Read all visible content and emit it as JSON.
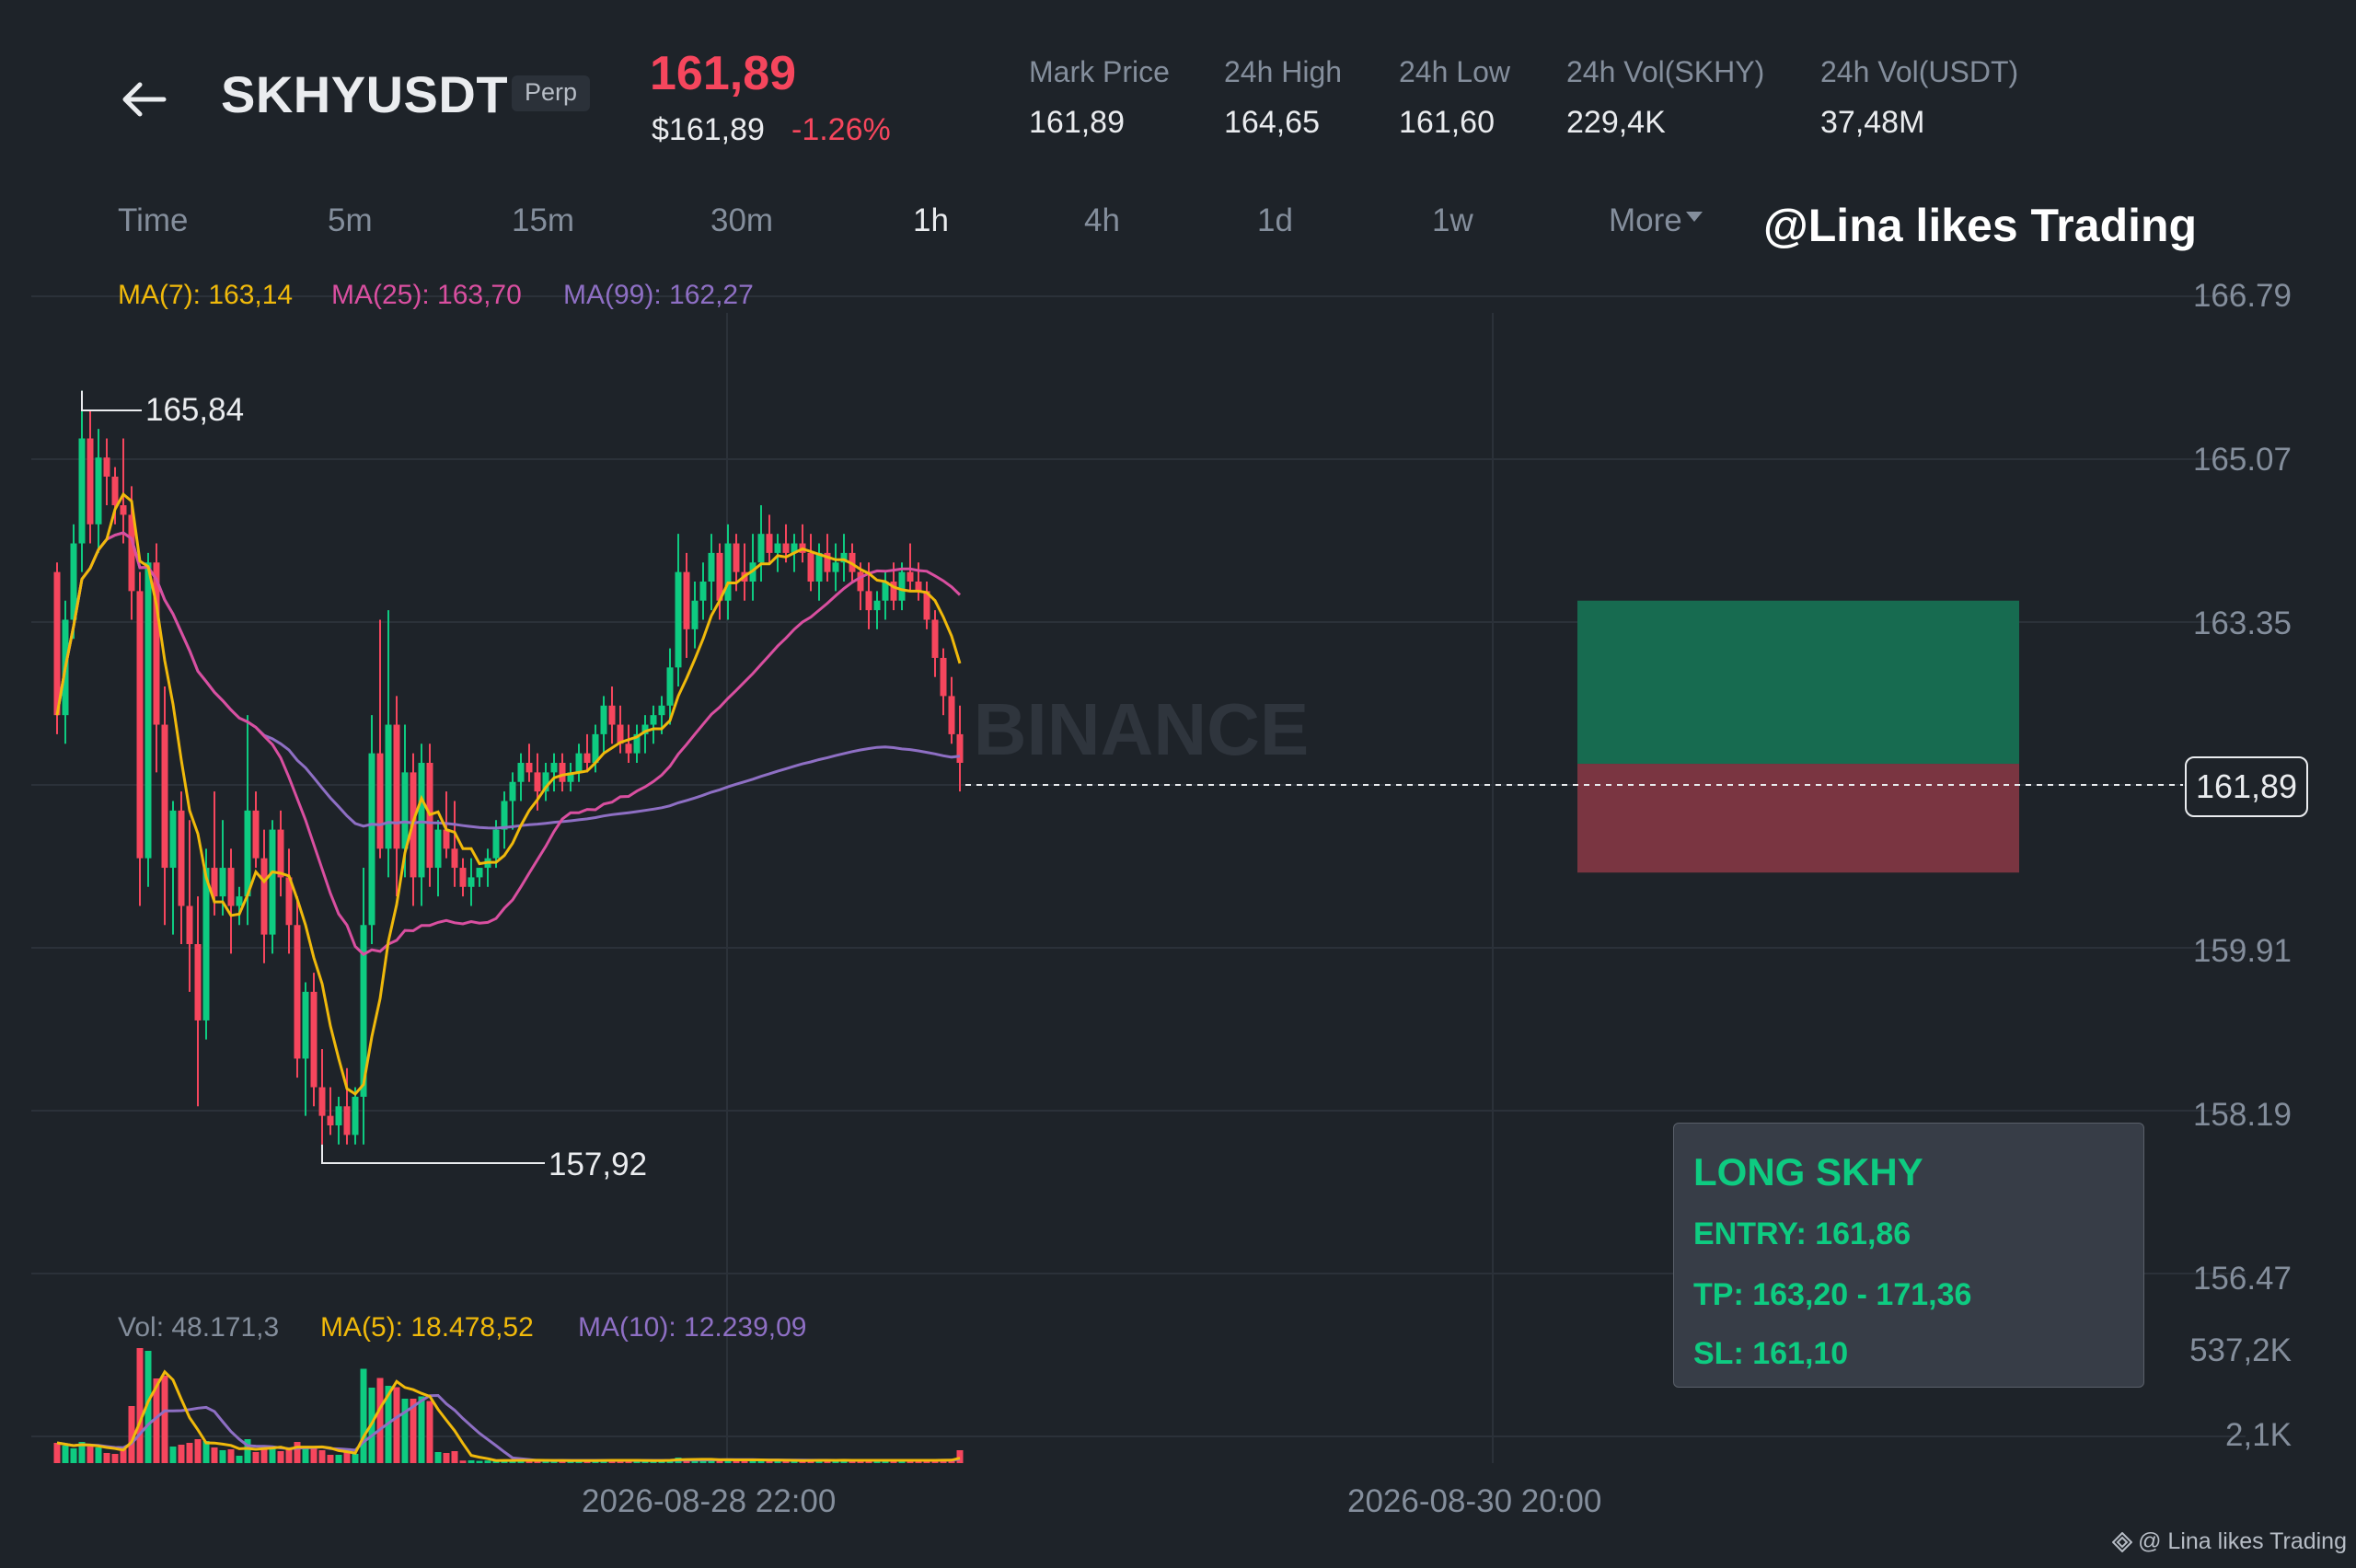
{
  "header": {
    "symbol": "SKHYUSDT",
    "badge": "Perp",
    "last_price": "161,89",
    "usd_price": "$161,89",
    "change_pct": "-1.26%",
    "stats": [
      {
        "label": "Mark Price",
        "value": "161,89"
      },
      {
        "label": "24h High",
        "value": "164,65"
      },
      {
        "label": "24h Low",
        "value": "161,60"
      },
      {
        "label": "24h Vol(SKHY)",
        "value": "229,4K"
      },
      {
        "label": "24h Vol(USDT)",
        "value": "37,48M"
      }
    ],
    "back_icon": "arrow-left-icon"
  },
  "timeframes": {
    "items": [
      "Time",
      "5m",
      "15m",
      "30m",
      "1h",
      "4h",
      "1d",
      "1w",
      "More"
    ],
    "active": "1h",
    "more_icon": "caret-down-icon"
  },
  "watermark": "@Lina likes Trading",
  "ma_legend": {
    "ma7": "MA(7): 163,14",
    "ma25": "MA(25): 163,70",
    "ma99": "MA(99): 162,27"
  },
  "price_axis": [
    "166.79",
    "165.07",
    "163.35",
    "161,89",
    "159.91",
    "158.19",
    "156.47"
  ],
  "current_price_tag": "161,89",
  "extremes": {
    "high": "165,84",
    "low": "157,92"
  },
  "volume_legend": {
    "vol": "Vol: 48.171,3",
    "ma5": "MA(5): 18.478,52",
    "ma10": "MA(10): 12.239,09"
  },
  "volume_axis": [
    "537,2K",
    "2,1K"
  ],
  "time_axis": [
    "2026-08-28 22:00",
    "2026-08-30 20:00"
  ],
  "signal": {
    "title": "LONG SKHY",
    "entry": "ENTRY: 161,86",
    "tp": "TP: 163,20 - 171,36",
    "sl": "SL: 161,10"
  },
  "footer_watermark": "@ Lina likes Trading",
  "colors": {
    "background": "#1e2329",
    "up": "#0ecb81",
    "down": "#f6465d",
    "ma7": "#f0b90b",
    "ma25": "#d94fa0",
    "ma99": "#8e6fc4",
    "tp_zone": "#176b50",
    "sl_zone": "#7a3541"
  },
  "chart_data": {
    "type": "candlestick",
    "interval": "1h",
    "price_range": [
      156.47,
      166.79
    ],
    "grid": true,
    "candles_ohlc": [
      [
        163.9,
        164.0,
        162.2,
        162.4
      ],
      [
        162.4,
        163.6,
        162.1,
        163.4
      ],
      [
        163.4,
        164.4,
        163.2,
        164.2
      ],
      [
        164.2,
        165.8,
        163.9,
        165.3
      ],
      [
        165.3,
        165.6,
        164.2,
        164.4
      ],
      [
        164.4,
        165.4,
        164.1,
        165.1
      ],
      [
        165.1,
        165.3,
        164.6,
        164.9
      ],
      [
        164.9,
        165.0,
        164.4,
        164.6
      ],
      [
        164.6,
        165.3,
        164.2,
        164.5
      ],
      [
        164.5,
        164.8,
        163.4,
        163.7
      ],
      [
        163.7,
        163.9,
        160.4,
        160.9
      ],
      [
        160.9,
        164.1,
        160.6,
        164.0
      ],
      [
        164.0,
        164.2,
        161.8,
        162.3
      ],
      [
        162.3,
        162.7,
        160.2,
        160.8
      ],
      [
        160.8,
        161.5,
        160.1,
        161.4
      ],
      [
        161.4,
        161.6,
        160.0,
        160.4
      ],
      [
        160.4,
        161.3,
        159.5,
        160.0
      ],
      [
        160.0,
        160.5,
        158.3,
        159.2
      ],
      [
        159.2,
        161.0,
        159.0,
        160.8
      ],
      [
        160.8,
        161.6,
        160.3,
        160.5
      ],
      [
        160.5,
        161.3,
        160.3,
        160.8
      ],
      [
        160.8,
        161.0,
        159.9,
        160.4
      ],
      [
        160.4,
        160.6,
        160.2,
        160.5
      ],
      [
        160.5,
        162.4,
        160.2,
        161.4
      ],
      [
        161.4,
        161.6,
        160.8,
        160.9
      ],
      [
        160.9,
        161.2,
        159.8,
        160.1
      ],
      [
        160.1,
        161.3,
        159.9,
        161.2
      ],
      [
        161.2,
        161.4,
        160.5,
        160.7
      ],
      [
        160.7,
        161.0,
        159.9,
        160.2
      ],
      [
        160.2,
        160.5,
        158.6,
        158.8
      ],
      [
        158.8,
        159.6,
        158.2,
        159.5
      ],
      [
        159.5,
        159.7,
        158.3,
        158.5
      ],
      [
        158.5,
        158.9,
        157.9,
        158.2
      ],
      [
        158.2,
        158.5,
        158.0,
        158.1
      ],
      [
        158.1,
        158.4,
        157.9,
        158.3
      ],
      [
        158.3,
        158.7,
        157.9,
        158.0
      ],
      [
        158.0,
        158.5,
        157.9,
        158.4
      ],
      [
        158.4,
        160.8,
        157.9,
        160.2
      ],
      [
        160.2,
        162.4,
        160.0,
        162.0
      ],
      [
        162.0,
        163.4,
        160.9,
        161.0
      ],
      [
        161.0,
        163.5,
        160.7,
        162.3
      ],
      [
        162.3,
        162.6,
        160.5,
        161.0
      ],
      [
        161.0,
        162.3,
        160.7,
        161.8
      ],
      [
        161.8,
        162.0,
        160.4,
        160.7
      ],
      [
        160.7,
        162.1,
        160.4,
        161.9
      ],
      [
        161.9,
        162.1,
        160.6,
        160.8
      ],
      [
        160.8,
        161.3,
        160.5,
        161.2
      ],
      [
        161.2,
        161.6,
        160.9,
        161.0
      ],
      [
        161.0,
        161.5,
        160.6,
        160.8
      ],
      [
        160.8,
        160.9,
        160.5,
        160.6
      ],
      [
        160.6,
        160.9,
        160.4,
        160.7
      ],
      [
        160.7,
        160.8,
        160.6,
        160.8
      ],
      [
        160.8,
        161.0,
        160.6,
        160.9
      ],
      [
        160.9,
        161.3,
        160.8,
        161.2
      ],
      [
        161.2,
        161.6,
        161.0,
        161.5
      ],
      [
        161.5,
        161.8,
        161.2,
        161.7
      ],
      [
        161.7,
        162.0,
        161.5,
        161.9
      ],
      [
        161.9,
        162.1,
        161.7,
        161.8
      ],
      [
        161.8,
        162.0,
        161.4,
        161.6
      ],
      [
        161.6,
        161.9,
        161.5,
        161.8
      ],
      [
        161.8,
        162.0,
        161.6,
        161.9
      ],
      [
        161.9,
        162.0,
        161.6,
        161.7
      ],
      [
        161.7,
        161.9,
        161.6,
        161.8
      ],
      [
        161.8,
        162.1,
        161.7,
        162.0
      ],
      [
        162.0,
        162.2,
        161.8,
        161.9
      ],
      [
        161.9,
        162.3,
        161.8,
        162.2
      ],
      [
        162.2,
        162.6,
        162.0,
        162.5
      ],
      [
        162.5,
        162.7,
        162.1,
        162.3
      ],
      [
        162.3,
        162.5,
        162.0,
        162.1
      ],
      [
        162.1,
        162.3,
        161.9,
        162.0
      ],
      [
        162.0,
        162.3,
        161.9,
        162.2
      ],
      [
        162.2,
        162.4,
        162.0,
        162.3
      ],
      [
        162.3,
        162.5,
        162.1,
        162.4
      ],
      [
        162.4,
        162.6,
        162.2,
        162.5
      ],
      [
        162.5,
        163.1,
        162.3,
        162.9
      ],
      [
        162.9,
        164.3,
        162.7,
        163.9
      ],
      [
        163.9,
        164.1,
        163.0,
        163.3
      ],
      [
        163.3,
        163.8,
        163.1,
        163.6
      ],
      [
        163.6,
        164.0,
        163.4,
        163.8
      ],
      [
        163.8,
        164.3,
        163.5,
        164.1
      ],
      [
        164.1,
        164.2,
        163.4,
        163.6
      ],
      [
        163.6,
        164.4,
        163.4,
        164.2
      ],
      [
        164.2,
        164.3,
        163.7,
        163.9
      ],
      [
        163.9,
        164.2,
        163.6,
        163.8
      ],
      [
        163.8,
        164.3,
        163.6,
        164.0
      ],
      [
        164.0,
        164.6,
        163.8,
        164.3
      ],
      [
        164.3,
        164.5,
        164.0,
        164.1
      ],
      [
        164.1,
        164.3,
        163.9,
        164.2
      ],
      [
        164.2,
        164.4,
        164.0,
        164.1
      ],
      [
        164.1,
        164.3,
        163.9,
        164.2
      ],
      [
        164.2,
        164.4,
        164.0,
        164.1
      ],
      [
        164.1,
        164.3,
        163.7,
        163.8
      ],
      [
        163.8,
        164.2,
        163.6,
        164.1
      ],
      [
        164.1,
        164.3,
        163.8,
        163.9
      ],
      [
        163.9,
        164.2,
        163.7,
        164.0
      ],
      [
        164.0,
        164.3,
        163.8,
        164.1
      ],
      [
        164.1,
        164.2,
        163.8,
        163.9
      ],
      [
        163.9,
        164.0,
        163.5,
        163.7
      ],
      [
        163.7,
        164.0,
        163.3,
        163.5
      ],
      [
        163.5,
        163.7,
        163.3,
        163.6
      ],
      [
        163.6,
        163.9,
        163.4,
        163.8
      ],
      [
        163.8,
        164.0,
        163.5,
        163.6
      ],
      [
        163.6,
        164.0,
        163.5,
        163.9
      ],
      [
        163.9,
        164.2,
        163.7,
        163.8
      ],
      [
        163.8,
        164.0,
        163.6,
        163.7
      ],
      [
        163.7,
        163.8,
        163.3,
        163.4
      ],
      [
        163.4,
        163.5,
        162.8,
        163.0
      ],
      [
        163.0,
        163.1,
        162.4,
        162.6
      ],
      [
        162.6,
        162.8,
        162.1,
        162.2
      ],
      [
        162.2,
        162.5,
        161.6,
        161.9
      ]
    ],
    "volume_series": [
      {
        "name": "Vol",
        "note": "relative scale"
      },
      {
        "name": "MA(5)"
      },
      {
        "name": "MA(10)"
      }
    ],
    "trade_setup": {
      "entry": 161.86,
      "tp_low": 163.2,
      "tp_high": 171.36,
      "sl": 161.1,
      "tp_zone": [
        161.89,
        163.6
      ],
      "sl_zone": [
        160.75,
        161.89
      ]
    }
  }
}
